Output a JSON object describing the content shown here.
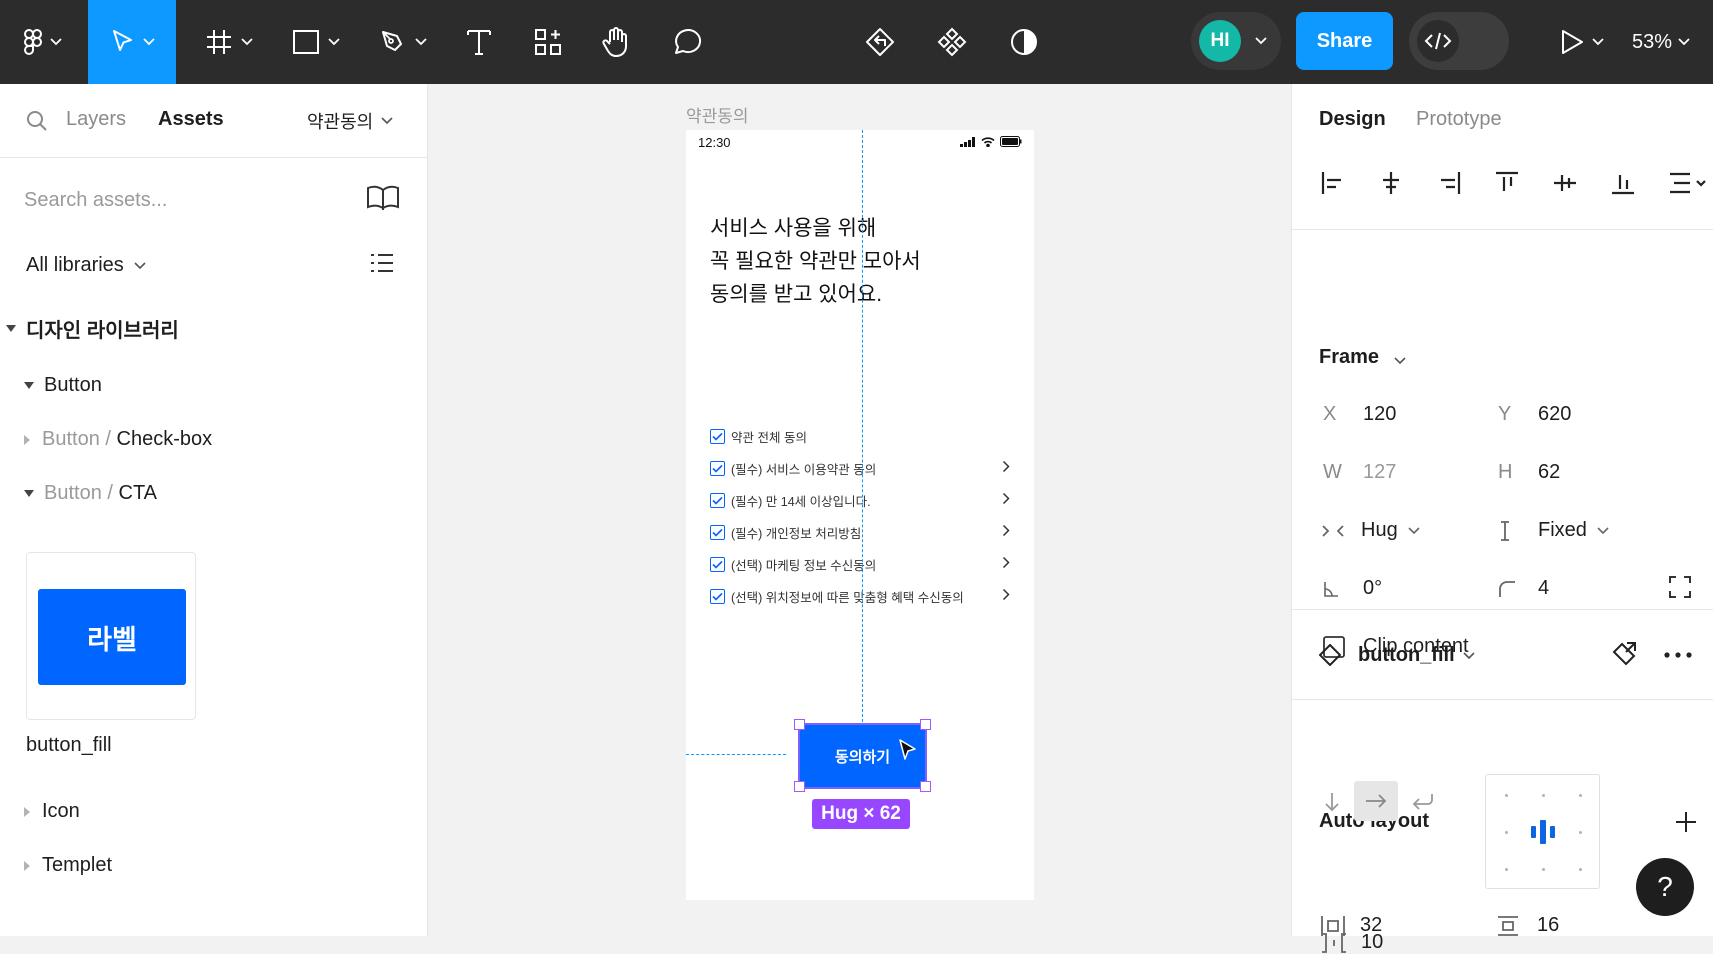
{
  "toolbar": {
    "share_label": "Share",
    "avatar_initials": "HI",
    "zoom_label": "53%"
  },
  "left_panel": {
    "tabs": {
      "layers": "Layers",
      "assets": "Assets"
    },
    "page_selector": "약관동의",
    "search_placeholder": "Search assets...",
    "library_filter": "All libraries",
    "library_name": "디자인 라이브러리",
    "tree": {
      "button": "Button",
      "checkbox_prefix": "Button / ",
      "checkbox": "Check-box",
      "cta_prefix": "Button / ",
      "cta": "CTA",
      "icon": "Icon",
      "templet": "Templet"
    },
    "asset": {
      "thumb_label": "라벨",
      "name": "button_fill"
    }
  },
  "canvas": {
    "frame_label": "약관동의",
    "status_time": "12:30",
    "headline": [
      "서비스 사용을 위해",
      "꼭 필요한 약관만 모아서",
      "동의를 받고 있어요."
    ],
    "checks": [
      {
        "label": "약관 전체 동의",
        "has_chevron": false
      },
      {
        "label": "(필수) 서비스 이용약관 동의",
        "has_chevron": true
      },
      {
        "label": "(필수) 만 14세 이상입니다.",
        "has_chevron": true
      },
      {
        "label": "(필수) 개인정보 처리방침",
        "has_chevron": true
      },
      {
        "label": "(선택) 마케팅 정보 수신동의",
        "has_chevron": true
      },
      {
        "label": "(선택) 위치정보에 따른 맞춤형 혜택 수신동의",
        "has_chevron": true
      }
    ],
    "cta_label": "동의하기",
    "size_badge": "Hug × 62"
  },
  "right_panel": {
    "tabs": {
      "design": "Design",
      "prototype": "Prototype"
    },
    "frame": {
      "title": "Frame",
      "x_label": "X",
      "x": "120",
      "y_label": "Y",
      "y": "620",
      "w_label": "W",
      "w": "127",
      "h_label": "H",
      "h": "62",
      "width_mode": "Hug",
      "height_mode": "Fixed",
      "rotation": "0°",
      "radius": "4",
      "clip_content": "Clip content"
    },
    "component": {
      "name": "button_fill"
    },
    "auto_layout": {
      "title": "Auto layout",
      "gap": "10",
      "padding_h": "32",
      "padding_v": "16"
    }
  },
  "colors": {
    "toolbar_bg": "#2c2c2c",
    "accent": "#0d99ff",
    "brand_button": "#0066ff",
    "selection": "#9747ff",
    "avatar": "#14b8a6"
  }
}
